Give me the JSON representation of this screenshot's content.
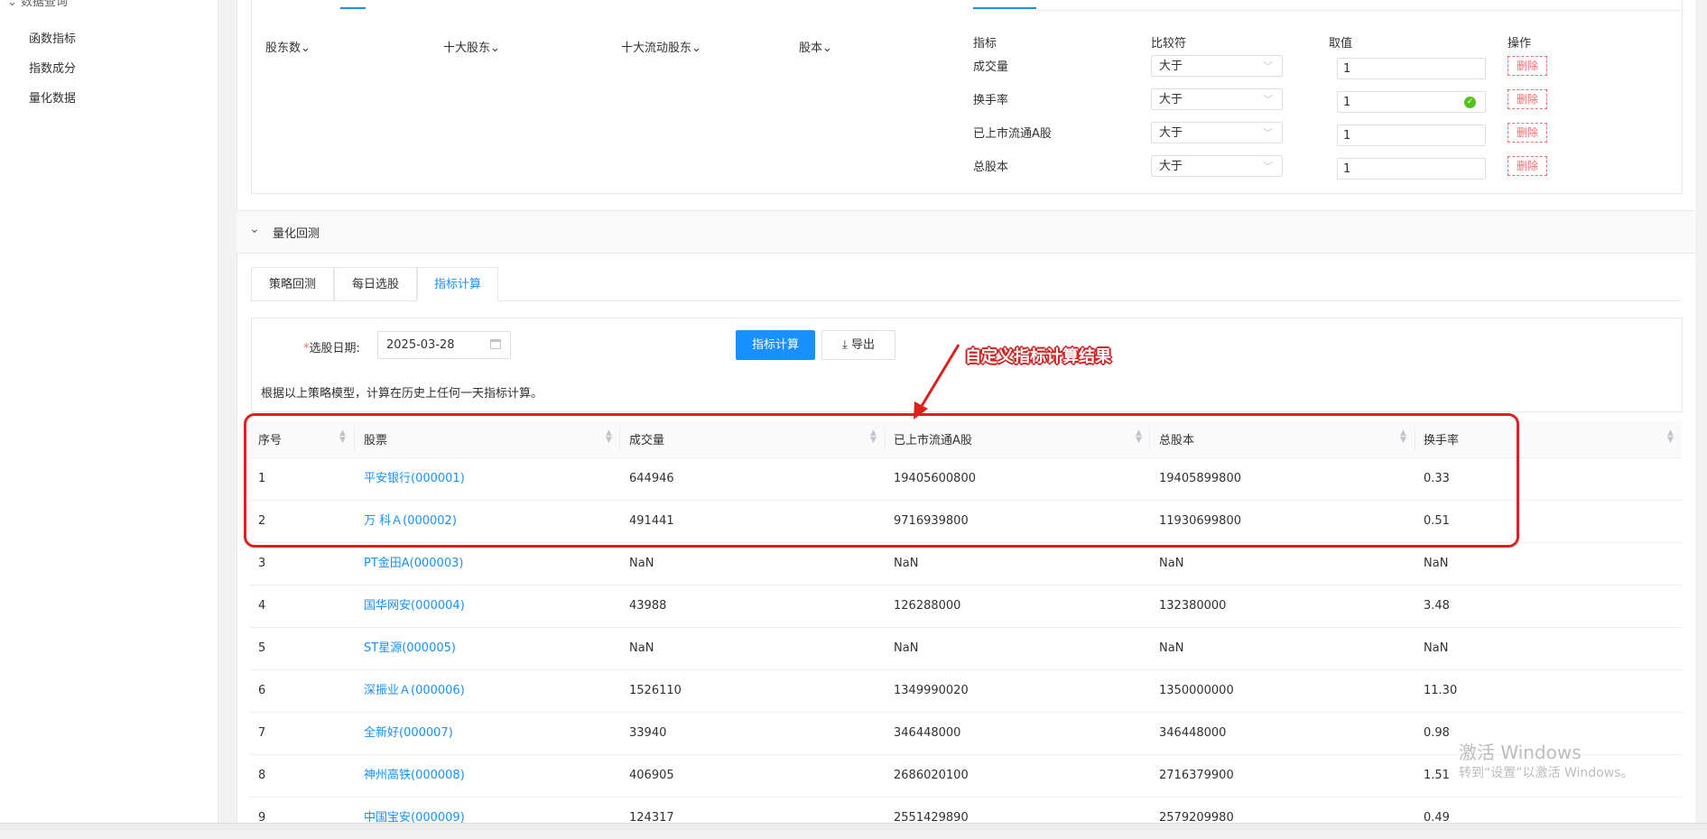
{
  "sidebar": {
    "top_cut_label": "数据查询",
    "items": [
      {
        "label": "函数指标"
      },
      {
        "label": "指数成分"
      },
      {
        "label": "量化数据"
      }
    ]
  },
  "filter": {
    "dropdowns": [
      "股东数",
      "十大股东",
      "十大流动股东",
      "股本"
    ],
    "conditions_header": {
      "indicator": "指标",
      "comparator": "比较符",
      "value": "取值",
      "action": "操作"
    },
    "conditions": [
      {
        "indicator": "成交量",
        "comparator": "大于",
        "value": "1",
        "valid": false
      },
      {
        "indicator": "换手率",
        "comparator": "大于",
        "value": "1",
        "valid": true
      },
      {
        "indicator": "已上市流通A股",
        "comparator": "大于",
        "value": "1",
        "valid": false
      },
      {
        "indicator": "总股本",
        "comparator": "大于",
        "value": "1",
        "valid": false
      }
    ],
    "delete_label": "删除"
  },
  "section": {
    "title": "量化回测"
  },
  "tabs": [
    {
      "label": "策略回测",
      "active": false
    },
    {
      "label": "每日选股",
      "active": false
    },
    {
      "label": "指标计算",
      "active": true
    }
  ],
  "form": {
    "required_mark": "*",
    "date_label": "选股日期:",
    "date_value": "2025-03-28",
    "calc_button": "指标计算",
    "export_button": "导出",
    "hint": "根据以上策略模型，计算在历史上任何一天指标计算。"
  },
  "annotation": {
    "text": "自定义指标计算结果",
    "color": "#e01f1f"
  },
  "table": {
    "columns": [
      "序号",
      "股票",
      "成交量",
      "已上市流通A股",
      "总股本",
      "换手率"
    ],
    "rows": [
      [
        "1",
        "平安银行(000001)",
        "644946",
        "19405600800",
        "19405899800",
        "0.33"
      ],
      [
        "2",
        "万 科Ａ(000002)",
        "491441",
        "9716939800",
        "11930699800",
        "0.51"
      ],
      [
        "3",
        "PT金田A(000003)",
        "NaN",
        "NaN",
        "NaN",
        "NaN"
      ],
      [
        "4",
        "国华网安(000004)",
        "43988",
        "126288000",
        "132380000",
        "3.48"
      ],
      [
        "5",
        "ST星源(000005)",
        "NaN",
        "NaN",
        "NaN",
        "NaN"
      ],
      [
        "6",
        "深振业Ａ(000006)",
        "1526110",
        "1349990020",
        "1350000000",
        "11.30"
      ],
      [
        "7",
        "全新好(000007)",
        "33940",
        "346448000",
        "346448000",
        "0.98"
      ],
      [
        "8",
        "神州高铁(000008)",
        "406905",
        "2686020100",
        "2716379900",
        "1.51"
      ],
      [
        "9",
        "中国宝安(000009)",
        "124317",
        "2551429890",
        "2579209980",
        "0.49"
      ]
    ]
  },
  "watermark": {
    "line1": "激活 Windows",
    "line2": "转到“设置”以激活 Windows。"
  },
  "colors": {
    "primary": "#1890ff",
    "danger": "#f56c6c",
    "annotation": "#e01f1f",
    "success": "#52c41a"
  }
}
